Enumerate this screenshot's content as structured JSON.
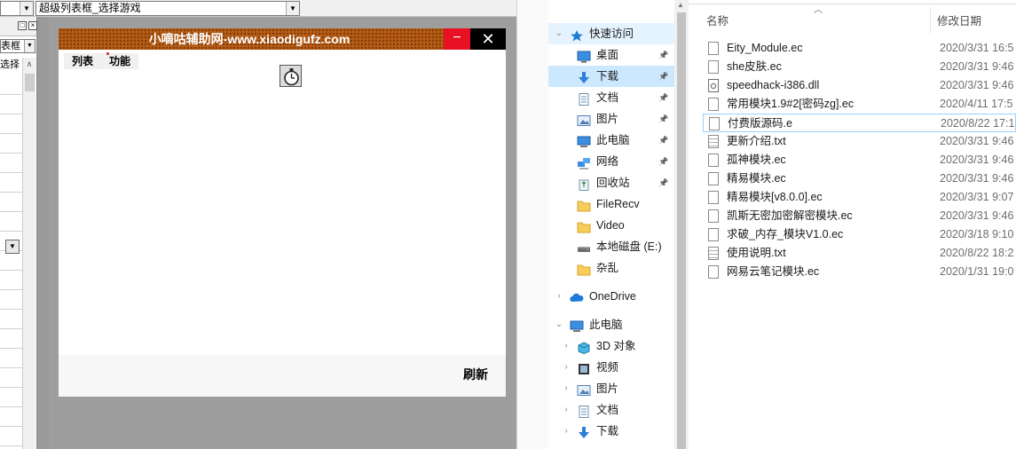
{
  "ide": {
    "combo_left_text": "",
    "combo_main_text": "超级列表框_选择游戏",
    "prop_combo_text": "表框",
    "prop_combo2_text": "选择"
  },
  "designer_window": {
    "title": "小嘀咕辅助网-www.xiaodigufz.com",
    "min_glyph": "−",
    "close_glyph": "✕",
    "tabs": [
      {
        "label": "列表"
      },
      {
        "label": "功能"
      }
    ],
    "refresh_label": "刷新"
  },
  "explorer": {
    "nav": [
      {
        "label": "快速访问",
        "icon": "star-icon",
        "type": "head",
        "expanded": true
      },
      {
        "label": "桌面",
        "icon": "desktop-icon",
        "pinned": true
      },
      {
        "label": "下载",
        "icon": "download-icon",
        "pinned": true,
        "selected": true
      },
      {
        "label": "文档",
        "icon": "document-icon",
        "pinned": true
      },
      {
        "label": "图片",
        "icon": "picture-icon",
        "pinned": true
      },
      {
        "label": "此电脑",
        "icon": "computer-icon",
        "pinned": true
      },
      {
        "label": "网络",
        "icon": "network-icon",
        "pinned": true
      },
      {
        "label": "回收站",
        "icon": "recycle-bin-icon",
        "pinned": true
      },
      {
        "label": "FileRecv",
        "icon": "folder-icon"
      },
      {
        "label": "Video",
        "icon": "folder-icon"
      },
      {
        "label": "本地磁盘 (E:)",
        "icon": "drive-icon"
      },
      {
        "label": "杂乱",
        "icon": "folder-icon"
      },
      {
        "label": "OneDrive",
        "icon": "cloud-icon",
        "type": "root"
      },
      {
        "label": "此电脑",
        "icon": "computer-icon",
        "type": "root",
        "expanded": true
      },
      {
        "label": "3D 对象",
        "icon": "3d-objects-icon"
      },
      {
        "label": "视频",
        "icon": "video-icon"
      },
      {
        "label": "图片",
        "icon": "picture-icon"
      },
      {
        "label": "文档",
        "icon": "document-icon"
      },
      {
        "label": "下载",
        "icon": "download-icon"
      }
    ],
    "columns": {
      "name": "名称",
      "modified": "修改日期"
    },
    "files": [
      {
        "name": "Eity_Module.ec",
        "date": "2020/3/31 16:5",
        "kind": "ec"
      },
      {
        "name": "she皮肤.ec",
        "date": "2020/3/31 9:46",
        "kind": "ec"
      },
      {
        "name": "speedhack-i386.dll",
        "date": "2020/3/31 9:46",
        "kind": "dll"
      },
      {
        "name": "常用模块1.9#2[密码zg].ec",
        "date": "2020/4/11 17:5",
        "kind": "ec"
      },
      {
        "name": "付费版源码.e",
        "date": "2020/8/22 17:1",
        "kind": "e",
        "focused": true
      },
      {
        "name": "更新介绍.txt",
        "date": "2020/3/31 9:46",
        "kind": "txt"
      },
      {
        "name": "孤神模块.ec",
        "date": "2020/3/31 9:46",
        "kind": "ec"
      },
      {
        "name": "精易模块.ec",
        "date": "2020/3/31 9:46",
        "kind": "ec"
      },
      {
        "name": "精易模块[v8.0.0].ec",
        "date": "2020/3/31 9:07",
        "kind": "ec"
      },
      {
        "name": "凯斯无密加密解密模块.ec",
        "date": "2020/3/31 9:46",
        "kind": "ec"
      },
      {
        "name": "求破_内存_模块V1.0.ec",
        "date": "2020/3/18 9:10",
        "kind": "ec"
      },
      {
        "name": "使用说明.txt",
        "date": "2020/8/22 18:2",
        "kind": "txt"
      },
      {
        "name": "网易云笔记模块.ec",
        "date": "2020/1/31 19:0",
        "kind": "ec"
      }
    ]
  },
  "colors": {
    "titlebar": "#b55b14",
    "minimize_bg": "#e81123",
    "close_bg": "#000000",
    "nav_selected": "#cce8ff"
  }
}
